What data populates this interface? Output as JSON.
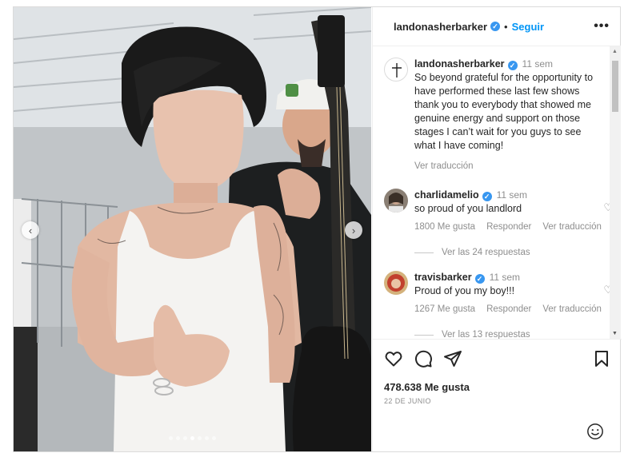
{
  "post": {
    "username": "landonasherbarker",
    "follow_label": "Seguir",
    "separator": "•",
    "more_label": "•••"
  },
  "caption": {
    "username": "landonasherbarker",
    "time": "11 sem",
    "text": "So beyond grateful for the opportunity to have performed these last few shows thank you to everybody that showed me genuine energy and support on those stages I can’t wait for you guys to see what I have coming!",
    "see_translation": "Ver traducción"
  },
  "comments": [
    {
      "username": "charlidamelio",
      "time": "11 sem",
      "text": "so proud of you landlord",
      "likes": "1800 Me gusta",
      "reply": "Responder",
      "translate": "Ver traducción",
      "replies": "Ver las 24 respuestas"
    },
    {
      "username": "travisbarker",
      "time": "11 sem",
      "text": "Proud of you my boy!!!",
      "likes": "1267 Me gusta",
      "reply": "Responder",
      "translate": "Ver traducción",
      "replies": "Ver las 13 respuestas"
    }
  ],
  "footer": {
    "likes": "478.638 Me gusta",
    "date": "22 DE JUNIO"
  },
  "carousel": {
    "slide_count": 7,
    "active_index": 3
  },
  "colors": {
    "accent": "#0095f6",
    "verified": "#3897f0",
    "muted": "#8e8e8e",
    "text": "#262626"
  },
  "icons": [
    "chevron-left-icon",
    "chevron-right-icon",
    "heart-icon",
    "comment-icon",
    "share-icon",
    "bookmark-icon",
    "emoji-icon",
    "verified-icon",
    "more-icon"
  ]
}
